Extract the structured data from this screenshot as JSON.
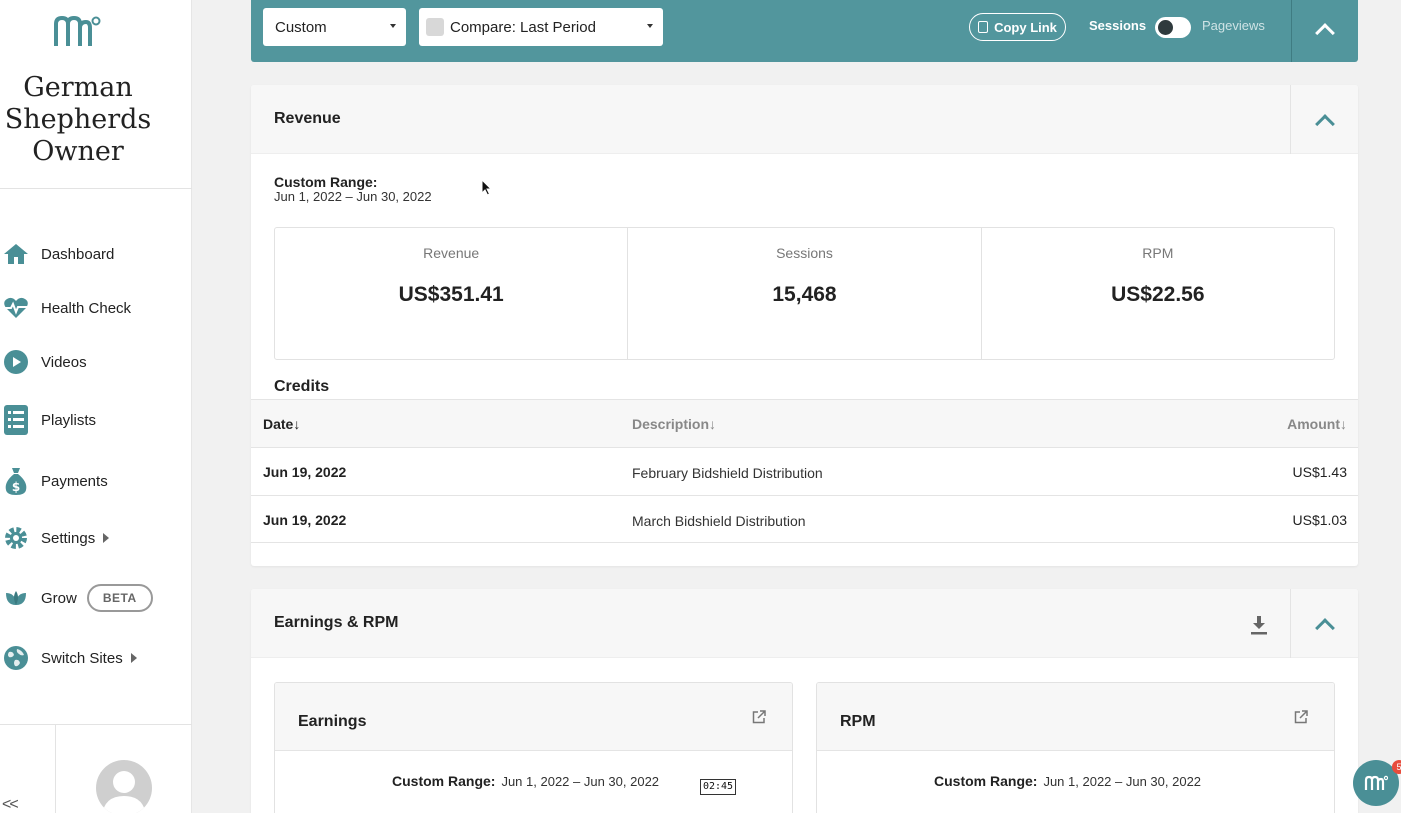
{
  "site": {
    "name_lines": [
      "German",
      "Shepherds",
      "Owner"
    ]
  },
  "nav": [
    {
      "label": "Dashboard",
      "icon": "home-icon"
    },
    {
      "label": "Health Check",
      "icon": "heartbeat-icon"
    },
    {
      "label": "Videos",
      "icon": "play-circle-icon"
    },
    {
      "label": "Playlists",
      "icon": "list-icon"
    },
    {
      "label": "Payments",
      "icon": "money-bag-icon"
    },
    {
      "label": "Settings",
      "icon": "gear-icon"
    },
    {
      "label": "Grow",
      "icon": "leaf-icon",
      "badge": "BETA"
    },
    {
      "label": "Switch Sites",
      "icon": "globe-icon"
    }
  ],
  "sidebar_collapse": "<<",
  "toolbar": {
    "range_select": "Custom",
    "compare_select": "Compare: Last Period",
    "copy_link": "Copy Link",
    "toggle_on_label": "Sessions",
    "toggle_off_label": "Pageviews"
  },
  "revenue": {
    "title": "Revenue",
    "range_label": "Custom Range:",
    "range_value": "Jun 1, 2022 – Jun 30, 2022",
    "stats": [
      {
        "label": "Revenue",
        "value": "US$351.41"
      },
      {
        "label": "Sessions",
        "value": "15,468"
      },
      {
        "label": "RPM",
        "value": "US$22.56"
      }
    ],
    "credits": {
      "title": "Credits",
      "headers": {
        "date": "Date↓",
        "description": "Description↓",
        "amount": "Amount↓"
      },
      "rows": [
        {
          "date": "Jun 19, 2022",
          "description": "February Bidshield Distribution",
          "amount": "US$1.43"
        },
        {
          "date": "Jun 19, 2022",
          "description": "March Bidshield Distribution",
          "amount": "US$1.03"
        }
      ]
    }
  },
  "earnings": {
    "title": "Earnings & RPM",
    "cards": [
      {
        "title": "Earnings",
        "range_label": "Custom Range:",
        "range_value": "Jun 1, 2022 – Jun 30, 2022"
      },
      {
        "title": "RPM",
        "range_label": "Custom Range:",
        "range_value": "Jun 1, 2022 – Jun 30, 2022"
      }
    ]
  },
  "overlay": {
    "timer": "02:45",
    "chat_badge": "5"
  },
  "colors": {
    "accent": "#52969d",
    "nav_icon": "#4a8f96"
  }
}
